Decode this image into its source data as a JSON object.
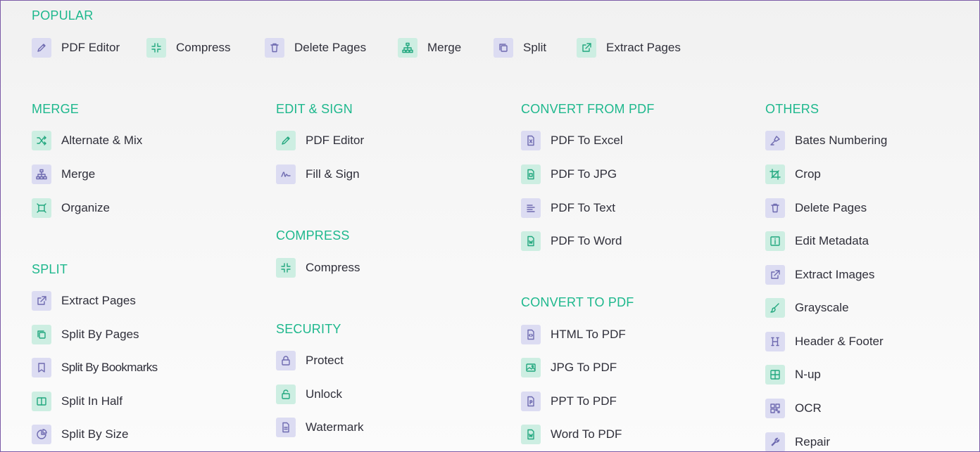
{
  "sections": {
    "popular": {
      "title": "POPULAR",
      "items": [
        "PDF Editor",
        "Compress",
        "Delete Pages",
        "Merge",
        "Split",
        "Extract Pages"
      ]
    },
    "merge": {
      "title": "MERGE",
      "items": [
        "Alternate & Mix",
        "Merge",
        "Organize"
      ]
    },
    "split": {
      "title": "SPLIT",
      "items": [
        "Extract Pages",
        "Split By Pages",
        "Split By Bookmarks",
        "Split In Half",
        "Split By Size"
      ]
    },
    "edit_sign": {
      "title": "EDIT & SIGN",
      "items": [
        "PDF Editor",
        "Fill & Sign"
      ]
    },
    "compress": {
      "title": "COMPRESS",
      "items": [
        "Compress"
      ]
    },
    "security": {
      "title": "SECURITY",
      "items": [
        "Protect",
        "Unlock",
        "Watermark"
      ]
    },
    "convert_from": {
      "title": "CONVERT FROM PDF",
      "items": [
        "PDF To Excel",
        "PDF To JPG",
        "PDF To Text",
        "PDF To Word"
      ]
    },
    "convert_to": {
      "title": "CONVERT TO PDF",
      "items": [
        "HTML To PDF",
        "JPG To PDF",
        "PPT To PDF",
        "Word To PDF"
      ]
    },
    "others": {
      "title": "OTHERS",
      "items": [
        "Bates Numbering",
        "Crop",
        "Delete Pages",
        "Edit Metadata",
        "Extract Images",
        "Grayscale",
        "Header & Footer",
        "N-up",
        "OCR",
        "Repair"
      ]
    }
  },
  "icons": {
    "popular": [
      "pencil-icon",
      "compress-icon",
      "trash-icon",
      "sitemap-icon",
      "copy-icon",
      "external-link-icon"
    ],
    "merge": [
      "shuffle-icon",
      "sitemap-icon",
      "organize-icon"
    ],
    "split": [
      "external-link-icon",
      "copy-icon",
      "bookmark-icon",
      "columns-icon",
      "pie-chart-icon"
    ],
    "edit_sign": [
      "pencil-icon",
      "signature-icon"
    ],
    "compress": [
      "compress-icon"
    ],
    "security": [
      "lock-icon",
      "unlock-icon",
      "document-icon"
    ],
    "convert_from": [
      "excel-file-icon",
      "image-file-icon",
      "text-lines-icon",
      "word-file-icon"
    ],
    "convert_to": [
      "html-file-icon",
      "image-icon",
      "ppt-file-icon",
      "word-file-icon"
    ],
    "others": [
      "stamp-icon",
      "crop-icon",
      "trash-icon",
      "info-icon",
      "external-link-icon",
      "brush-icon",
      "header-icon",
      "grid-icon",
      "qr-code-icon",
      "wrench-icon"
    ]
  },
  "colors": {
    "accent": "#1eb88d",
    "purple_icon_bg": "#dcdcf2",
    "green_icon_bg": "#cdeee2",
    "text": "#2f2f3a",
    "frame_border": "#7b5aa6"
  }
}
